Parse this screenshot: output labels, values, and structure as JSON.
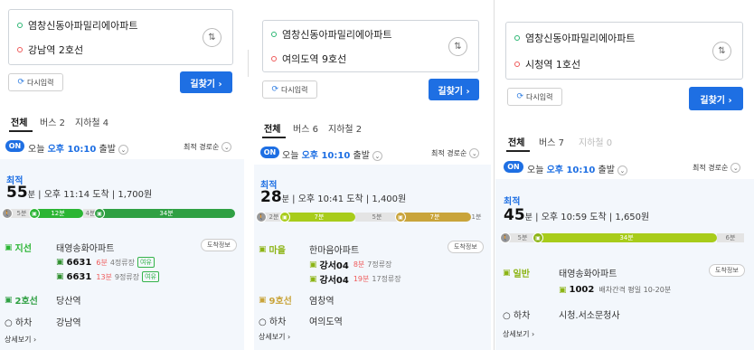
{
  "colors": {
    "accent": "#1e6fe3",
    "green_bus": "#2bb534",
    "mint": "#2fb34a",
    "village": "#a8cc1a",
    "line9": "#c9a43a",
    "line2": "#2fa043",
    "line1": "#2a4aa0",
    "red": "#ef5a5a"
  },
  "panels": [
    {
      "origin": "염창신동아파밀리에아파트",
      "dest": "강남역 2호선",
      "reset": "다시입력",
      "search": "길찾기 ›",
      "tabs": [
        "전체",
        "버스 2",
        "지하철 4"
      ],
      "on_label": "ON",
      "dep_prefix": "오늘",
      "dep_time": "오후 10:10",
      "dep_suffix": "출발",
      "sort": "최적 경로순",
      "best": "최적",
      "minutes": "55",
      "min_unit": "분",
      "arrive": "| 오후 11:14 도착",
      "fare": "| 1,700원",
      "bar": [
        {
          "label": "5분",
          "type": "walk"
        },
        {
          "label": "12분",
          "type": "bus"
        },
        {
          "label": "4분",
          "type": "walk"
        },
        {
          "label": "34분",
          "type": "sub"
        }
      ],
      "legs": [
        {
          "mode": "지선",
          "stop": "태영송화아파트",
          "info": "도착정보",
          "lines": [
            {
              "num": "6631",
              "mins": "6분",
              "stops": "4정류장",
              "tag": "여유"
            },
            {
              "num": "6631",
              "mins": "13분",
              "stops": "9정류장",
              "tag": "여유"
            }
          ]
        },
        {
          "mode": "2호선",
          "stop": "당산역"
        },
        {
          "mode": "하차",
          "stop": "강남역"
        }
      ],
      "more": "상세보기 ›"
    },
    {
      "origin": "염창신동아파밀리에아파트",
      "dest": "여의도역 9호선",
      "reset": "다시입력",
      "search": "길찾기 ›",
      "tabs": [
        "전체",
        "버스 6",
        "지하철 2"
      ],
      "on_label": "ON",
      "dep_prefix": "오늘",
      "dep_time": "오후 10:10",
      "dep_suffix": "출발",
      "sort": "최적 경로순",
      "best": "최적",
      "minutes": "28",
      "min_unit": "분",
      "arrive": "| 오후 10:41 도착",
      "fare": "| 1,400원",
      "bar": [
        {
          "label": "2분",
          "type": "walk"
        },
        {
          "label": "7분",
          "type": "village"
        },
        {
          "label": "5분",
          "type": "walk"
        },
        {
          "label": "7분",
          "type": "line9"
        },
        {
          "label": "1분",
          "type": "walk"
        }
      ],
      "legs": [
        {
          "mode": "마을",
          "stop": "한마음아파트",
          "info": "도착정보",
          "lines": [
            {
              "num": "강서04",
              "mins": "8분",
              "stops": "7정류장"
            },
            {
              "num": "강서04",
              "mins": "19분",
              "stops": "17정류장"
            }
          ]
        },
        {
          "mode": "9호선",
          "stop": "염창역"
        },
        {
          "mode": "하차",
          "stop": "여의도역"
        }
      ],
      "more": "상세보기 ›"
    },
    {
      "origin": "염창신동아파밀리에아파트",
      "dest": "시청역 1호선",
      "reset": "다시입력",
      "search": "길찾기 ›",
      "tabs": [
        "전체",
        "버스 7",
        "지하철 0"
      ],
      "on_label": "ON",
      "dep_prefix": "오늘",
      "dep_time": "오후 10:10",
      "dep_suffix": "출발",
      "sort": "최적 경로순",
      "best": "최적",
      "minutes": "45",
      "min_unit": "분",
      "arrive": "| 오후 10:59 도착",
      "fare": "| 1,650원",
      "bar": [
        {
          "label": "5분",
          "type": "walk"
        },
        {
          "label": "34분",
          "type": "village"
        },
        {
          "label": "6분",
          "type": "walk"
        }
      ],
      "legs": [
        {
          "mode": "일반",
          "stop": "태영송화아파트",
          "info": "도착정보",
          "lines": [
            {
              "num": "1002",
              "interval": "배차간격 평일 10-20분"
            }
          ]
        },
        {
          "mode": "하차",
          "stop": "시청.서소문청사"
        }
      ],
      "more": "상세보기 ›"
    }
  ]
}
